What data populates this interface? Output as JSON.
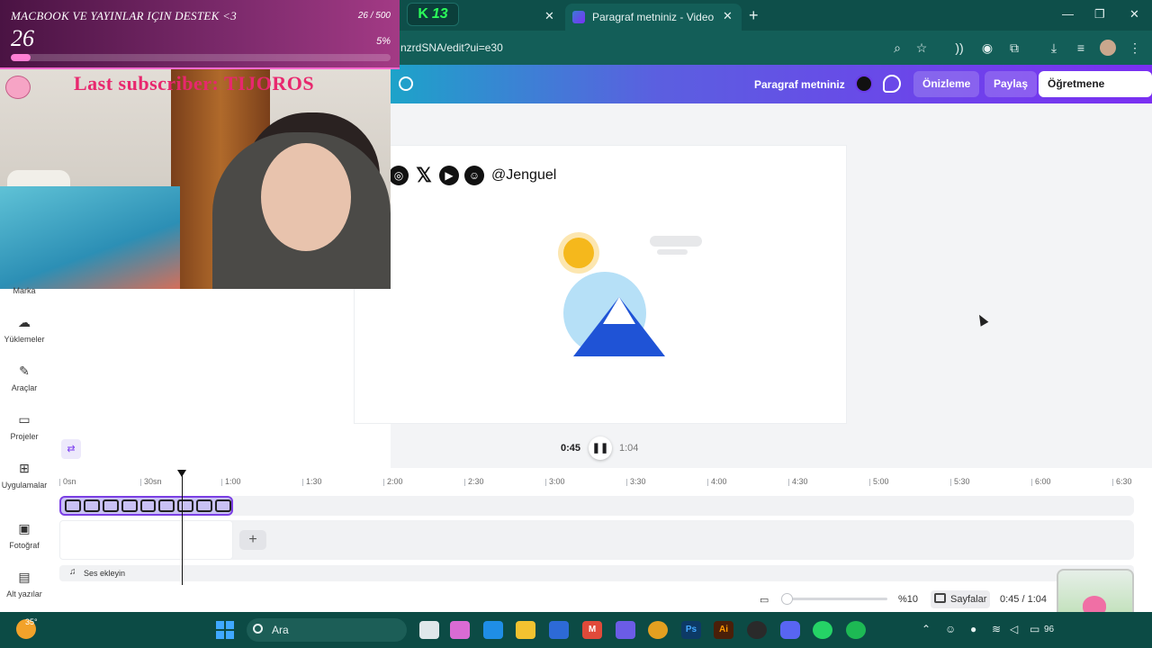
{
  "overlay": {
    "goal_title": "MACBOOK VE YAYINLAR IÇIN DESTEK <3",
    "goal_count": "26 / 500",
    "goal_current": "26",
    "goal_percent": "5%",
    "goal_progress": 0.052,
    "last_subscriber": "Last subscriber: TIJOROS"
  },
  "browser": {
    "extension_tab_label": "13",
    "active_tab_title": "Paragraf metniniz - Video",
    "url": "nzrdSNA/edit?ui=e30"
  },
  "canva_header": {
    "doc_title": "Paragraf metniniz",
    "preview_label": "Önizleme",
    "share_label": "Paylaş",
    "send_label": "Öğretmene gönder"
  },
  "sidebar": {
    "items": [
      {
        "label": "Marka",
        "icon": "brand-icon"
      },
      {
        "label": "Yüklemeler",
        "icon": "cloud-upload-icon"
      },
      {
        "label": "Araçlar",
        "icon": "pen-icon"
      },
      {
        "label": "Projeler",
        "icon": "folder-icon"
      },
      {
        "label": "Uygulamalar",
        "icon": "apps-grid-icon"
      },
      {
        "label": "Fotoğraf",
        "icon": "image-icon"
      },
      {
        "label": "Alt yazılar",
        "icon": "captions-icon"
      }
    ]
  },
  "canvas": {
    "social_handle": "@Jenguel"
  },
  "playback": {
    "current": "0:45",
    "total": "1:04"
  },
  "timeline": {
    "ticks": [
      "0sn",
      "30sn",
      "1:00",
      "1:30",
      "2:00",
      "2:30",
      "3:00",
      "3:30",
      "4:00",
      "4:30",
      "5:00",
      "5:30",
      "6:00",
      "6:30"
    ],
    "add_audio_label": "Ses ekleyin"
  },
  "footer": {
    "zoom": "%10",
    "pages_label": "Sayfalar",
    "time_readout": "0:45 / 1:04"
  },
  "taskbar": {
    "weather_temp": "35°",
    "search_label": "Ara",
    "battery": "96"
  },
  "colors": {
    "accent_purple": "#7b3fe4",
    "header_start": "#1da3c9",
    "header_end": "#7a2ff2",
    "browser_green": "#135e58"
  }
}
